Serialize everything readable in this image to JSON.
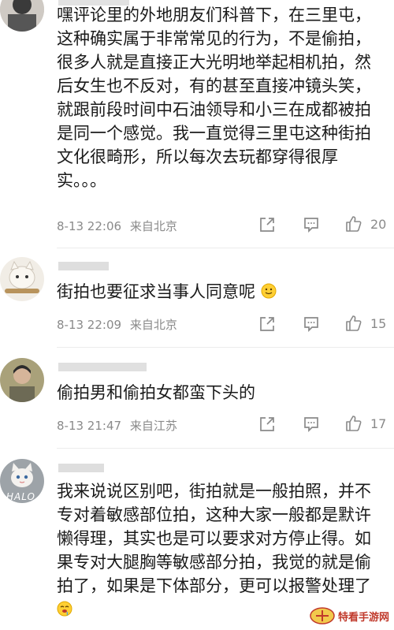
{
  "comments": [
    {
      "text": "嘿评论里的外地朋友们科普下，在三里屯，这种确实属于非常常见的行为，不是偷拍，很多人就是直接正大光明地举起相机拍，然后女生也不反对，有的甚至直接冲镜头笑，就跟前段时间中石油领导和小三在成都被拍是同一个感觉。我一直觉得三里屯这种街拍文化很畸形，所以每次去玩都穿得很厚实。。。",
      "time": "8-13 22:06",
      "location": "来自北京",
      "likes": "20"
    },
    {
      "text": "街拍也要征求当事人同意呢",
      "time": "8-13 22:09",
      "location": "来自北京",
      "likes": "15"
    },
    {
      "text": "偷拍男和偷拍女都蛮下头的",
      "time": "8-13 21:47",
      "location": "来自江苏",
      "likes": "17"
    },
    {
      "text": "我来说说区别吧，街拍就是一般拍照，并不专对着敏感部位拍，这种大家一般都是默许懒得理，其实也是可以要求对方停止得。如果专对大腿胸等敏感部分拍，我觉的就是偷拍了，如果是下体部分，更可以报警处理了",
      "avatar_caption": "HALO"
    }
  ],
  "watermark": {
    "text": "特看手游网"
  },
  "icons": {
    "share": "share-icon",
    "comment": "comment-icon",
    "like": "thumbs-up-icon",
    "smile": "smile-emoji-icon",
    "drool": "drool-emoji-icon"
  },
  "colors": {
    "text": "#1a1a1a",
    "meta": "#8a8a8a",
    "watermark": "#c0392b"
  }
}
